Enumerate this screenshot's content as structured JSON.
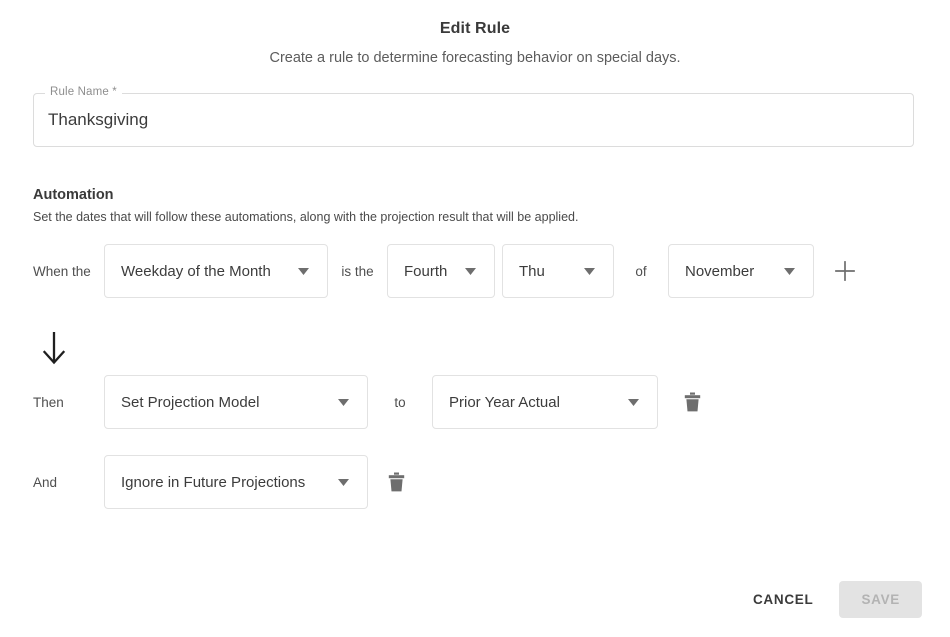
{
  "header": {
    "title": "Edit Rule",
    "subtitle": "Create a rule to determine forecasting behavior on special days."
  },
  "rule_name": {
    "label": "Rule Name *",
    "value": "Thanksgiving",
    "placeholder": "Rule Name"
  },
  "automation": {
    "title": "Automation",
    "description": "Set the dates that will follow these automations, along with the projection result that will be applied."
  },
  "conditions": {
    "when_label": "When the",
    "is_the_label": "is the",
    "of_label": "of",
    "type": "Weekday of the Month",
    "ordinal": "Fourth",
    "weekday": "Thu",
    "month": "November",
    "add_icon": "plus-icon"
  },
  "actions": [
    {
      "row_label": "Then",
      "action": "Set Projection Model",
      "conj": "to",
      "value": "Prior Year Actual",
      "delete_icon": "trash-icon"
    },
    {
      "row_label": "And",
      "action": "Ignore in Future Projections",
      "conj": "",
      "value": "",
      "delete_icon": "trash-icon"
    }
  ],
  "flow": {
    "arrow_icon": "arrow-down-icon"
  },
  "footer": {
    "cancel_label": "CANCEL",
    "save_label": "SAVE"
  },
  "colors": {
    "border": "#e2e2e2",
    "text": "#3c3c3c",
    "muted": "#8e8e8e",
    "disabled_bg": "#e3e3e3",
    "disabled_text": "#b3b3b3"
  }
}
